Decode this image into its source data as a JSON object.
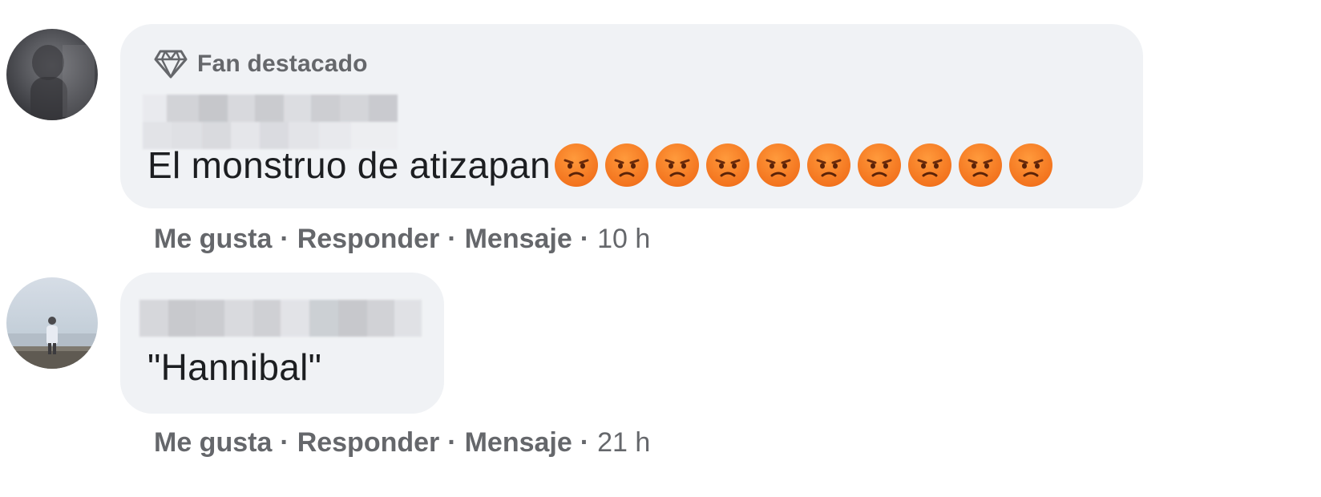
{
  "comments": [
    {
      "badge": "Fan destacado",
      "badge_icon": "diamond-icon",
      "text": "El monstruo de atizapan",
      "reaction_emoji": "angry-face-icon",
      "reaction_emoji_count": 10,
      "actions": {
        "like": "Me gusta",
        "reply": "Responder",
        "message": "Mensaje",
        "time": "10 h"
      }
    },
    {
      "text": "\"Hannibal\"",
      "actions": {
        "like": "Me gusta",
        "reply": "Responder",
        "message": "Mensaje",
        "time": "21 h"
      }
    }
  ],
  "colors": {
    "bubble": "#f0f2f5",
    "secondary_text": "#65676b",
    "primary_text": "#1c1e21",
    "emoji": "#f2711c"
  }
}
